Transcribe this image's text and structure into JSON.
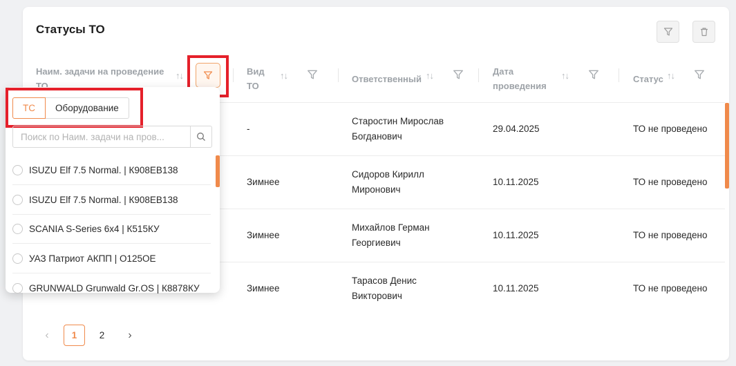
{
  "title": "Статусы ТО",
  "columns": [
    {
      "label_line1": "Наим. задачи на проведение",
      "label_line2": "ТО"
    },
    {
      "label_line1": "Вид",
      "label_line2": "ТО"
    },
    {
      "label_line1": "Ответственный",
      "label_line2": ""
    },
    {
      "label_line1": "Дата",
      "label_line2": "проведения"
    },
    {
      "label_line1": "Статус",
      "label_line2": ""
    }
  ],
  "sort_glyph": "↑↓",
  "rows": [
    {
      "type": "-",
      "responsible_l1": "Старостин Мирослав",
      "responsible_l2": "Богданович",
      "date": "29.04.2025",
      "status": "ТО не проведено"
    },
    {
      "type": "Зимнее",
      "responsible_l1": "Сидоров Кирилл",
      "responsible_l2": "Миронович",
      "date": "10.11.2025",
      "status": "ТО не проведено"
    },
    {
      "type": "Зимнее",
      "responsible_l1": "Михайлов Герман",
      "responsible_l2": "Георгиевич",
      "date": "10.11.2025",
      "status": "ТО не проведено"
    },
    {
      "type": "Зимнее",
      "responsible_l1": "Тарасов Денис",
      "responsible_l2": "Викторович",
      "date": "10.11.2025",
      "status": "ТО не проведено"
    }
  ],
  "filter_dropdown": {
    "segments": [
      "ТС",
      "Оборудование"
    ],
    "active_segment": "ТС",
    "search_placeholder": "Поиск по Наим. задачи на пров...",
    "options": [
      "ISUZU Elf 7.5 Normal. | К908ЕВ138",
      "ISUZU Elf 7.5 Normal. | К908ЕВ138",
      "SCANIA S-Series 6x4 | К515КУ",
      "УАЗ Патриот АКПП | О125ОЕ",
      "GRUNWALD Grunwald Gr.OS | К8878КУ"
    ]
  },
  "pagination": {
    "prev": "‹",
    "current": "1",
    "other": "2",
    "next": "›"
  },
  "colors": {
    "accent": "#f08a4b",
    "highlight_box": "#e5202a",
    "header_text": "#9ea3a8"
  },
  "icons": [
    "filter-icon",
    "trash-icon",
    "search-icon",
    "sort-icon"
  ]
}
